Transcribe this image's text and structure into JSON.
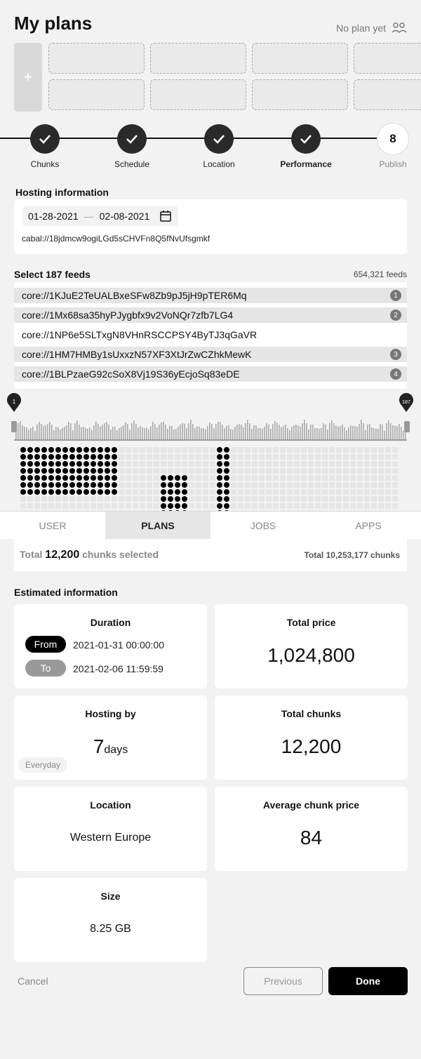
{
  "header": {
    "title": "My plans",
    "no_plan_text": "No plan yet"
  },
  "plan_slots": {
    "add_label": "+"
  },
  "stepper": {
    "steps": [
      {
        "label": "Chunks",
        "done": true
      },
      {
        "label": "Schedule",
        "done": true
      },
      {
        "label": "Location",
        "done": true
      },
      {
        "label": "Performance",
        "done": true,
        "current": true
      },
      {
        "label": "Publish",
        "number": "8"
      }
    ]
  },
  "hosting": {
    "section_title": "Hosting information",
    "date_from": "01-28-2021",
    "date_separator": "—",
    "date_to": "02-08-2021",
    "cabal": "cabal://18jdmcw9ogiLGd5sCHVFn8Q5fNvUfsgmkf"
  },
  "feeds": {
    "section_title": "Select 187 feeds",
    "total": "654,321 feeds",
    "rows": [
      {
        "key": "core://1KJuE2TeUALBxeSFw8Zb9pJ5jH9pTER6Mq",
        "badge": "1"
      },
      {
        "key": "core://1Mx68sa35hyPJygbfx9v2VoNQr7zfb7LG4",
        "badge": "2"
      },
      {
        "key": "core://1NP6e5SLTxgN8VHnRSCCPSY4ByTJ3qGaVR",
        "badge": ""
      },
      {
        "key": "core://1HM7HMBy1sUxxzN57XF3XtJrZwCZhkMewK",
        "badge": "3"
      },
      {
        "key": "core://1BLPzaeG92cSoX8Vj19S36yEcjoSq83eDE",
        "badge": "4"
      }
    ]
  },
  "slider": {
    "min_label": "1",
    "max_label": "187"
  },
  "tabs": [
    {
      "label": "USER",
      "active": false
    },
    {
      "label": "PLANS",
      "active": true
    },
    {
      "label": "JOBS",
      "active": false
    },
    {
      "label": "APPS",
      "active": false
    }
  ],
  "totals": {
    "left_prefix": "Total",
    "selected_chunks": "12,200",
    "left_suffix": "chunks selected",
    "right": "Total 10,253,177 chunks"
  },
  "estimated": {
    "section_title": "Estimated information",
    "duration": {
      "title": "Duration",
      "from_label": "From",
      "from_value": "2021-01-31 00:00:00",
      "to_label": "To",
      "to_value": "2021-02-06 11:59:59"
    },
    "total_price": {
      "title": "Total price",
      "value": "1,024,800"
    },
    "hosting_by": {
      "title": "Hosting by",
      "value": "7",
      "unit": "days",
      "tag": "Everyday"
    },
    "total_chunks": {
      "title": "Total chunks",
      "value": "12,200"
    },
    "location": {
      "title": "Location",
      "value": "Western Europe"
    },
    "avg_chunk_price": {
      "title": "Average chunk price",
      "value": "84"
    },
    "size": {
      "title": "Size",
      "value": "8.25 GB"
    }
  },
  "actions": {
    "cancel": "Cancel",
    "previous": "Previous",
    "done": "Done"
  },
  "colors": {
    "accent": "#000000",
    "step_done": "#2a2a2a",
    "badge": "#777777"
  }
}
